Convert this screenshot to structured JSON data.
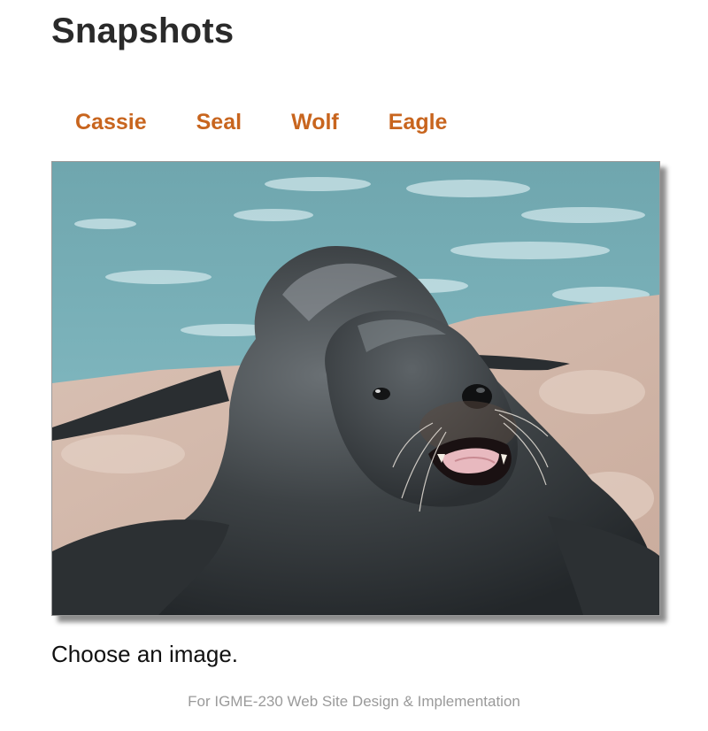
{
  "page": {
    "title": "Snapshots",
    "caption": "Choose an image.",
    "footer": "For IGME-230 Web Site Design & Implementation"
  },
  "nav": {
    "items": [
      {
        "label": "Cassie"
      },
      {
        "label": "Seal"
      },
      {
        "label": "Wolf"
      },
      {
        "label": "Eagle"
      }
    ]
  },
  "photo": {
    "subject": "sea lion on rocks beside pool"
  },
  "colors": {
    "link": "#c8651e",
    "title": "#2a2a2a",
    "footer": "#9a9a9a"
  }
}
